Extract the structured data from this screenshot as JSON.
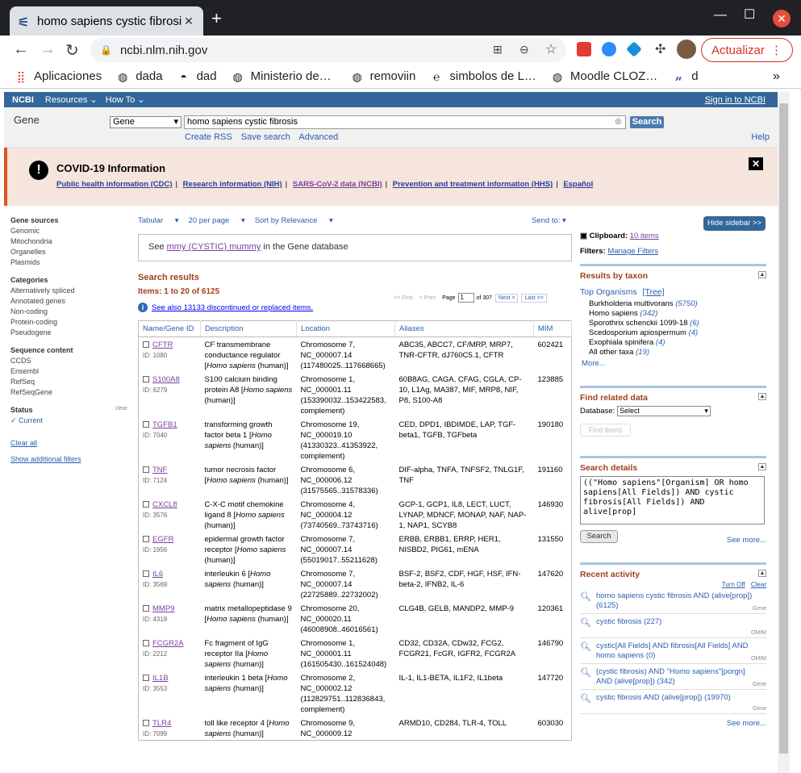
{
  "browser": {
    "tab_title": "homo sapiens cystic fibrosi",
    "url": "ncbi.nlm.nih.gov",
    "update_label": "Actualizar",
    "bookmarks": [
      "Aplicaciones",
      "dada",
      "dad",
      "Ministerio de…",
      "removiin",
      "simbolos de L…",
      "Moodle CLOZ…",
      "d"
    ]
  },
  "ncbi": {
    "logo": "NCBI",
    "resources": "Resources",
    "howto": "How To",
    "signin": "Sign in to NCBI",
    "db_label": "Gene",
    "db_select": "Gene",
    "query": "homo sapiens cystic fibrosis",
    "search_btn": "Search",
    "create_rss": "Create RSS",
    "save_search": "Save search",
    "advanced": "Advanced",
    "help": "Help"
  },
  "covid": {
    "title": "COVID-19 Information",
    "links": [
      "Public health information (CDC)",
      "Research information (NIH)",
      "SARS-CoV-2 data (NCBI)",
      "Prevention and treatment information (HHS)",
      "Español"
    ]
  },
  "left": {
    "gene_sources": "Gene sources",
    "sources": [
      "Genomic",
      "Mitochondria",
      "Organelles",
      "Plasmids"
    ],
    "categories": "Categories",
    "cats": [
      "Alternatively spliced",
      "Annotated genes",
      "Non-coding",
      "Protein-coding",
      "Pseudogene"
    ],
    "seq_content": "Sequence content",
    "seqs": [
      "CCDS",
      "Ensembl",
      "RefSeq",
      "RefSeqGene"
    ],
    "status": "Status",
    "clear": "clear",
    "current": "Current",
    "clear_all": "Clear all",
    "show_filters": "Show additional filters"
  },
  "main": {
    "format": "Tabular",
    "perpage": "20 per page",
    "sort": "Sort by Relevance",
    "sendto": "Send to:",
    "didyou_pre": "See",
    "didyou_link": "mmy (CYSTIC) mummy",
    "didyou_post": "in the Gene database",
    "results_title": "Search results",
    "items": "Items: 1 to 20 of 6125",
    "first": "<< First",
    "prev": "< Prev",
    "page_label": "Page",
    "page": "1",
    "of": "of 307",
    "next": "Next >",
    "last": "Last >>",
    "seealso": "See also 13133 discontinued or replaced items.",
    "headers": [
      "Name/Gene ID",
      "Description",
      "Location",
      "Aliases",
      "MIM"
    ],
    "rows": [
      {
        "name": "CFTR",
        "id": "ID: 1080",
        "desc": "CF transmembrane conductance regulator [Homo sapiens (human)]",
        "loc": "Chromosome 7, NC_000007.14 (117480025..117668665)",
        "alias": "ABC35, ABCC7, CF/MRP, MRP7, TNR-CFTR, dJ760C5.1, CFTR",
        "mim": "602421"
      },
      {
        "name": "S100A8",
        "id": "ID: 6279",
        "desc": "S100 calcium binding protein A8 [Homo sapiens (human)]",
        "loc": "Chromosome 1, NC_000001.11 (153390032..153422583, complement)",
        "alias": "60B8AG, CAGA, CFAG, CGLA, CP-10, L1Ag, MA387, MIF, MRP8, NIF, P8, S100-A8",
        "mim": "123885"
      },
      {
        "name": "TGFB1",
        "id": "ID: 7040",
        "desc": "transforming growth factor beta 1 [Homo sapiens (human)]",
        "loc": "Chromosome 19, NC_000019.10 (41330323..41353922, complement)",
        "alias": "CED, DPD1, IBDIMDE, LAP, TGF-beta1, TGFB, TGFbeta",
        "mim": "190180"
      },
      {
        "name": "TNF",
        "id": "ID: 7124",
        "desc": "tumor necrosis factor [Homo sapiens (human)]",
        "loc": "Chromosome 6, NC_000006.12 (31575565..31578336)",
        "alias": "DIF-alpha, TNFA, TNFSF2, TNLG1F, TNF",
        "mim": "191160"
      },
      {
        "name": "CXCL8",
        "id": "ID: 3576",
        "desc": "C-X-C motif chemokine ligand 8 [Homo sapiens (human)]",
        "loc": "Chromosome 4, NC_000004.12 (73740569..73743716)",
        "alias": "GCP-1, GCP1, IL8, LECT, LUCT, LYNAP, MDNCF, MONAP, NAF, NAP-1, NAP1, SCYB8",
        "mim": "146930"
      },
      {
        "name": "EGFR",
        "id": "ID: 1956",
        "desc": "epidermal growth factor receptor [Homo sapiens (human)]",
        "loc": "Chromosome 7, NC_000007.14 (55019017..55211628)",
        "alias": "ERBB, ERBB1, ERRP, HER1, NISBD2, PIG61, mENA",
        "mim": "131550"
      },
      {
        "name": "IL6",
        "id": "ID: 3569",
        "desc": "interleukin 6 [Homo sapiens (human)]",
        "loc": "Chromosome 7, NC_000007.14 (22725889..22732002)",
        "alias": "BSF-2, BSF2, CDF, HGF, HSF, IFN-beta-2, IFNB2, IL-6",
        "mim": "147620"
      },
      {
        "name": "MMP9",
        "id": "ID: 4318",
        "desc": "matrix metallopeptidase 9 [Homo sapiens (human)]",
        "loc": "Chromosome 20, NC_000020.11 (46008908..46016561)",
        "alias": "CLG4B, GELB, MANDP2, MMP-9",
        "mim": "120361"
      },
      {
        "name": "FCGR2A",
        "id": "ID: 2212",
        "desc": "Fc fragment of IgG receptor IIa [Homo sapiens (human)]",
        "loc": "Chromosome 1, NC_000001.11 (161505430..161524048)",
        "alias": "CD32, CD32A, CDw32, FCG2, FCGR21, FcGR, IGFR2, FCGR2A",
        "mim": "146790"
      },
      {
        "name": "IL1B",
        "id": "ID: 3553",
        "desc": "interleukin 1 beta [Homo sapiens (human)]",
        "loc": "Chromosome 2, NC_000002.12 (112829751..112836843, complement)",
        "alias": "IL-1, IL1-BETA, IL1F2, IL1beta",
        "mim": "147720"
      },
      {
        "name": "TLR4",
        "id": "ID: 7099",
        "desc": "toll like receptor 4 [Homo sapiens (human)]",
        "loc": "Chromosome 9, NC_000009.12",
        "alias": "ARMD10, CD284, TLR-4, TOLL",
        "mim": "603030"
      }
    ]
  },
  "right": {
    "hide_sidebar": "Hide sidebar >>",
    "clipboard_label": "Clipboard:",
    "clipboard_items": "10 items",
    "filters_label": "Filters:",
    "manage_filters": "Manage Filters",
    "taxon_title": "Results by taxon",
    "top_org": "Top Organisms",
    "tree": "[Tree]",
    "taxa": [
      {
        "name": "Burkholderia multivorans",
        "count": "(5750)"
      },
      {
        "name": "Homo sapiens",
        "count": "(342)"
      },
      {
        "name": "Sporothrix schenckii 1099-18",
        "count": "(6)"
      },
      {
        "name": "Scedosporium apiospermum",
        "count": "(4)"
      },
      {
        "name": "Exophiala spinifera",
        "count": "(4)"
      },
      {
        "name": "All other taxa",
        "count": "(19)"
      }
    ],
    "more": "More...",
    "related_title": "Find related data",
    "database_label": "Database:",
    "database_select": "Select",
    "find_items": "Find items",
    "details_title": "Search details",
    "details_query": "((\"Homo sapiens\"[Organism] OR homo sapiens[All Fields]) AND cystic fibrosis[All Fields]) AND alive[prop]",
    "search": "Search",
    "see_more": "See more...",
    "recent_title": "Recent activity",
    "turn_off": "Turn Off",
    "clear": "Clear",
    "activity": [
      {
        "text": "homo sapiens cystic fibrosis AND (alive[prop]) (6125)",
        "db": "Gene"
      },
      {
        "text": "cystic fibrosis (227)",
        "db": "OMIM"
      },
      {
        "text": "cystic[All Fields] AND fibrosis[All Fields] AND homo sapiens (0)",
        "db": "OMIM"
      },
      {
        "text": "(cystic fibrosis) AND \"Homo sapiens\"[porgn] AND (alive[prop]) (342)",
        "db": "Gene"
      },
      {
        "text": "cystic fibrosis AND (alive[prop]) (19970)",
        "db": "Gene"
      }
    ],
    "see_more2": "See more..."
  }
}
